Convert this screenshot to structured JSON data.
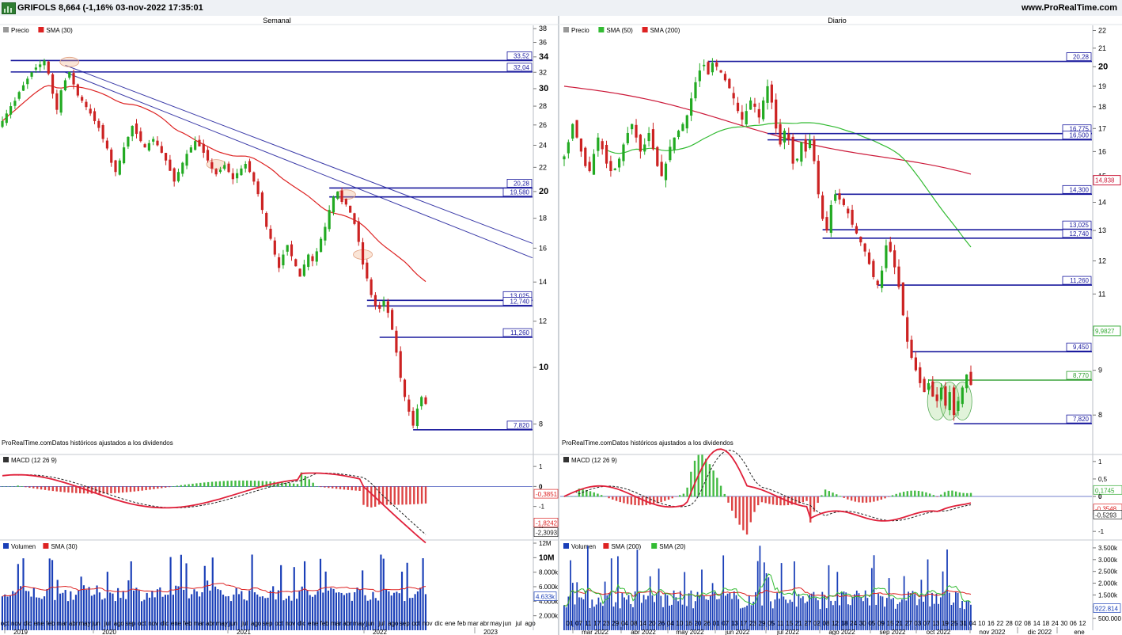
{
  "header": {
    "title": "GRIFOLS 8,664 (-1,16% 03-nov-2022 17:35:01",
    "site": "www.ProRealTime.com"
  },
  "source_note": "ProRealTime.comDatos históricos ajustados a los dividendos",
  "colors": {
    "up": "#22aa22",
    "down": "#cc2222",
    "level": "#1a1a9e",
    "trend": "#3a3aa8",
    "sma_red": "#dd2222",
    "sma_green": "#33bb33",
    "sma_crimson": "#cc1a3a",
    "volume": "#1a3fb8",
    "macd_line": "#e0203a",
    "signal": "#222222"
  },
  "chart_data": [
    {
      "panel": "Semanal",
      "type": "candlestick",
      "legend": [
        "Precio",
        "SMA (30)"
      ],
      "y_scale": "log",
      "ylim": [
        7.6,
        38.5
      ],
      "y_ticks": [
        "38",
        "36",
        "34",
        "32",
        "30",
        "28",
        "26",
        "24",
        "22",
        "20",
        "18",
        "16",
        "14",
        "12",
        "10",
        "8"
      ],
      "bold_ticks": [
        "34",
        "30",
        "20",
        "10"
      ],
      "x_months": [
        "oct",
        "nov",
        "dic",
        "ene",
        "feb",
        "mar",
        "abr",
        "may",
        "jun",
        "jul",
        "ago",
        "sep",
        "oct",
        "nov",
        "dic",
        "ene",
        "feb",
        "mar",
        "abr",
        "may",
        "jun",
        "jul",
        "ago",
        "sep",
        "oct",
        "nov",
        "dic",
        "ene",
        "feb",
        "mar",
        "abr",
        "may",
        "jun",
        "jul",
        "ago",
        "sep",
        "oct",
        "nov",
        "dic",
        "ene",
        "feb",
        "mar",
        "abr",
        "may",
        "jun",
        "jul",
        "ago"
      ],
      "x_years": [
        "2019",
        "2020",
        "2021",
        "2022",
        "2023"
      ],
      "closes": [
        26.4,
        27.2,
        28.0,
        28.6,
        29.6,
        30.4,
        31.2,
        32.0,
        32.6,
        33.0,
        33.52,
        31.8,
        29.4,
        27.6,
        29.8,
        31.0,
        32.04,
        30.5,
        29.2,
        28.6,
        27.9,
        27.2,
        26.4,
        25.7,
        24.6,
        23.7,
        22.4,
        21.6,
        22.6,
        23.8,
        24.8,
        25.9,
        25.1,
        24.4,
        23.8,
        24.2,
        24.6,
        24.0,
        23.3,
        22.6,
        21.7,
        20.8,
        21.6,
        22.4,
        23.2,
        23.8,
        24.4,
        23.9,
        23.3,
        22.6,
        21.9,
        21.4,
        21.8,
        22.2,
        21.6,
        21.0,
        21.5,
        21.9,
        22.3,
        21.6,
        20.8,
        19.8,
        18.6,
        17.4,
        16.6,
        15.6,
        14.8,
        15.6,
        16.2,
        15.5,
        14.9,
        14.3,
        15.0,
        15.6,
        15.2,
        15.8,
        16.6,
        17.4,
        18.6,
        19.6,
        20.0,
        19.2,
        19.0,
        18.4,
        17.6,
        16.4,
        15.0,
        14.2,
        13.3,
        12.74,
        12.6,
        13.0,
        12.4,
        11.6,
        10.6,
        9.6,
        8.9,
        8.4,
        7.95,
        8.5,
        8.9,
        8.66
      ],
      "sma_label": "SMA (30)",
      "levels": [
        {
          "label": "33,52",
          "value": 33.52,
          "from": 2
        },
        {
          "label": "32,04",
          "value": 32.04,
          "from": 2
        },
        {
          "label": "20,28",
          "value": 20.28,
          "from": 78
        },
        {
          "label": "19,580",
          "value": 19.58,
          "from": 78
        },
        {
          "label": "13,025",
          "value": 13.025,
          "from": 87
        },
        {
          "label": "12,740",
          "value": 12.74,
          "from": 87
        },
        {
          "label": "11,260",
          "value": 11.26,
          "from": 90
        },
        {
          "label": "7,820",
          "value": 7.82,
          "from": 98
        }
      ],
      "trendlines": [
        {
          "x1": 15,
          "y1": 32.9,
          "x2": 118,
          "y2": 16.3
        },
        {
          "x1": 15,
          "y1": 32.0,
          "x2": 118,
          "y2": 15.4
        }
      ],
      "touch_marks": [
        16,
        51,
        82,
        86
      ]
    },
    {
      "panel": "Diario",
      "type": "candlestick",
      "legend": [
        "Precio",
        "SMA (50)",
        "SMA (200)"
      ],
      "y_scale": "log",
      "ylim": [
        7.55,
        22.3
      ],
      "y_ticks": [
        "22",
        "21",
        "20",
        "19",
        "18",
        "17",
        "16",
        "15",
        "14",
        "13",
        "12",
        "11",
        "10",
        "9",
        "8"
      ],
      "bold_ticks": [
        "20",
        "10"
      ],
      "x_days": [
        "01",
        "07",
        "11",
        "17",
        "23",
        "29",
        "04",
        "08",
        "14",
        "20",
        "26",
        "04",
        "10",
        "16",
        "20",
        "26",
        "01",
        "07",
        "13",
        "17",
        "23",
        "29",
        "05",
        "11",
        "15",
        "21",
        "27",
        "02",
        "08",
        "12",
        "18",
        "24",
        "30",
        "05",
        "09",
        "15",
        "21",
        "27",
        "03",
        "07",
        "13",
        "19",
        "25",
        "31",
        "04",
        "10",
        "16",
        "22",
        "28",
        "02",
        "08",
        "14",
        "18",
        "24",
        "30",
        "06",
        "12"
      ],
      "x_months": [
        "mar 2022",
        "abr 2022",
        "may 2022",
        "jun 2022",
        "jul 2022",
        "ago 2022",
        "sep 2022",
        "oct 2022",
        "nov 2022",
        "dic 2022",
        "ene"
      ],
      "closes": [
        15.8,
        16.4,
        17.2,
        16.6,
        16.0,
        15.4,
        15.2,
        15.9,
        16.6,
        16.1,
        15.5,
        15.2,
        15.3,
        15.7,
        16.3,
        16.8,
        17.2,
        16.6,
        16.0,
        16.3,
        16.8,
        16.1,
        15.4,
        15.0,
        15.5,
        16.2,
        16.6,
        16.9,
        17.2,
        17.6,
        18.4,
        19.2,
        19.8,
        20.1,
        19.6,
        20.2,
        20.0,
        19.7,
        19.3,
        18.9,
        18.4,
        17.8,
        17.4,
        17.8,
        18.3,
        18.0,
        17.5,
        18.3,
        19.0,
        18.2,
        17.0,
        16.3,
        16.9,
        16.5,
        15.5,
        15.7,
        16.4,
        16.0,
        16.5,
        15.6,
        14.3,
        13.4,
        13.0,
        13.9,
        14.3,
        14.1,
        13.9,
        13.6,
        13.2,
        12.9,
        12.6,
        12.3,
        11.9,
        11.5,
        11.26,
        11.7,
        12.5,
        12.3,
        11.8,
        11.2,
        10.4,
        9.7,
        9.3,
        9.0,
        8.7,
        8.5,
        8.7,
        8.4,
        8.3,
        8.6,
        8.2,
        8.5,
        8.0,
        8.3,
        8.6,
        8.9,
        8.66
      ],
      "sma_labels": [
        "SMA (50)",
        "SMA (200)"
      ],
      "levels": [
        {
          "label": "20,28",
          "value": 20.28,
          "from": 34
        },
        {
          "label": "16,775",
          "value": 16.775,
          "from": 48
        },
        {
          "label": "16,500",
          "value": 16.5,
          "from": 48
        },
        {
          "label": "14,300",
          "value": 14.3,
          "from": 64
        },
        {
          "label": "13,025",
          "value": 13.025,
          "from": 61
        },
        {
          "label": "12,740",
          "value": 12.74,
          "from": 61
        },
        {
          "label": "11,260",
          "value": 11.26,
          "from": 74
        },
        {
          "label": "9,450",
          "value": 9.45,
          "from": 82
        },
        {
          "label": "7,820",
          "value": 7.82,
          "from": 92
        }
      ],
      "green_level": {
        "label": "8,770",
        "value": 8.77,
        "from": 86
      },
      "axis_boxes": [
        {
          "label": "14,838",
          "value": 14.838,
          "color": "#cc1a3a"
        },
        {
          "label": "9,9827",
          "value": 9.9827,
          "color": "#33aa33"
        }
      ],
      "ellipse_marks": [
        88,
        91,
        94
      ]
    }
  ],
  "macd": [
    {
      "legend": "MACD (12 26 9)",
      "ticks": [
        "1",
        "0",
        "-1",
        "-2"
      ],
      "values": [
        -0.3851,
        -1.8242,
        -2.3093
      ],
      "labels": [
        "-0,3851",
        "-1,8242",
        "-2,3093"
      ]
    },
    {
      "legend": "MACD (12 26 9)",
      "ticks": [
        "1",
        "0,5",
        "0",
        "-0,5",
        "-1"
      ],
      "values": [
        0.1745,
        -0.3548,
        -0.5293
      ],
      "labels": [
        "0,1745",
        "-0,3548",
        "-0,5293"
      ]
    }
  ],
  "volume": [
    {
      "legend": [
        "Volumen",
        "SMA (30)"
      ],
      "ticks": [
        "12M",
        "10M",
        "8.000k",
        "6.000k",
        "4.000k",
        "2.000k"
      ],
      "bold_ticks": [
        "10M"
      ],
      "box": "4.633k",
      "box_value": 4633
    },
    {
      "legend": [
        "Volumen",
        "SMA (200)",
        "SMA (20)"
      ],
      "ticks": [
        "3.500k",
        "3.000k",
        "2.500k",
        "2.000k",
        "1.500k",
        "1.000k",
        "500.000"
      ],
      "box": "922.814",
      "box_value": 922.814
    }
  ],
  "panel_titles": {
    "left": "Semanal",
    "right": "Diario"
  }
}
